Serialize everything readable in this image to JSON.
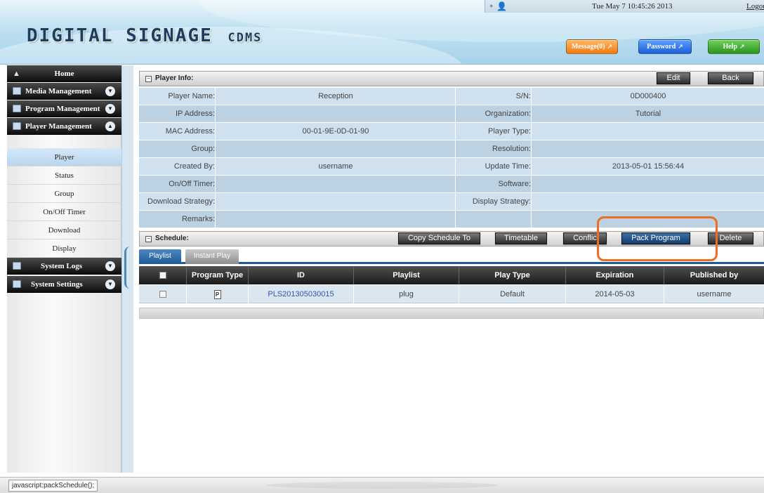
{
  "header": {
    "logo_main": "DIGITAL SIGNAGE",
    "logo_sub": "CDMS",
    "datetime": "Tue May 7 10:45:26 2013",
    "logout": "Logou",
    "message_label": "Message(0)",
    "password_label": "Password",
    "help_label": "Help",
    "colors": {
      "message": "#f07a12",
      "password": "#1e5fd6",
      "help": "#2c9320"
    }
  },
  "sidebar": {
    "menus": [
      {
        "label": "Home",
        "icon": "home-icon"
      },
      {
        "label": "Media Management",
        "icon": "media-icon",
        "chevron": "down"
      },
      {
        "label": "Program Management",
        "icon": "program-icon",
        "chevron": "down"
      },
      {
        "label": "Player Management",
        "icon": "player-icon",
        "chevron": "up"
      }
    ],
    "player_items": [
      "Player",
      "Status",
      "Group",
      "On/Off Timer",
      "Download",
      "Display"
    ],
    "bottom_menus": [
      {
        "label": "System Logs",
        "icon": "logs-icon",
        "chevron": "down"
      },
      {
        "label": "System Settings",
        "icon": "settings-icon",
        "chevron": "down"
      }
    ]
  },
  "player_info": {
    "title": "Player Info:",
    "edit_label": "Edit",
    "back_label": "Back",
    "rows": [
      {
        "l1": "Player Name:",
        "v1": "Reception",
        "l2": "S/N:",
        "v2": "0D000400"
      },
      {
        "l1": "IP Address:",
        "v1": "",
        "l2": "Organization:",
        "v2": "Tutorial"
      },
      {
        "l1": "MAC Address:",
        "v1": "00-01-9E-0D-01-90",
        "l2": "Player Type:",
        "v2": ""
      },
      {
        "l1": "Group:",
        "v1": "",
        "l2": "Resolution:",
        "v2": ""
      },
      {
        "l1": "Created By:",
        "v1": "username",
        "l2": "Update Time:",
        "v2": "2013-05-01 15:56:44"
      },
      {
        "l1": "On/Off Timer:",
        "v1": "",
        "l2": "Software:",
        "v2": ""
      },
      {
        "l1": "Download Strategy:",
        "v1": "",
        "l2": "Display Strategy:",
        "v2": ""
      },
      {
        "l1": "Remarks:",
        "v1": "",
        "l2": "",
        "v2": ""
      }
    ]
  },
  "schedule": {
    "title": "Schedule:",
    "buttons": {
      "copy": "Copy Schedule To",
      "timetable": "Timetable",
      "conflict": "Conflic",
      "pack": "Pack Program",
      "delete": "Delete"
    },
    "tabs": [
      "Playlist",
      "Instant Play"
    ],
    "columns": [
      "",
      "Program Type",
      "ID",
      "Playlist",
      "Play Type",
      "Expiration",
      "Published by"
    ],
    "rows": [
      {
        "id": "PLS201305030015",
        "playlist": "plug",
        "play_type": "Default",
        "expiration": "2014-05-03",
        "published_by": "username"
      }
    ]
  },
  "statusbar": {
    "text": "javascript:packSchedule();"
  },
  "highlight_color": "#ef6a22"
}
